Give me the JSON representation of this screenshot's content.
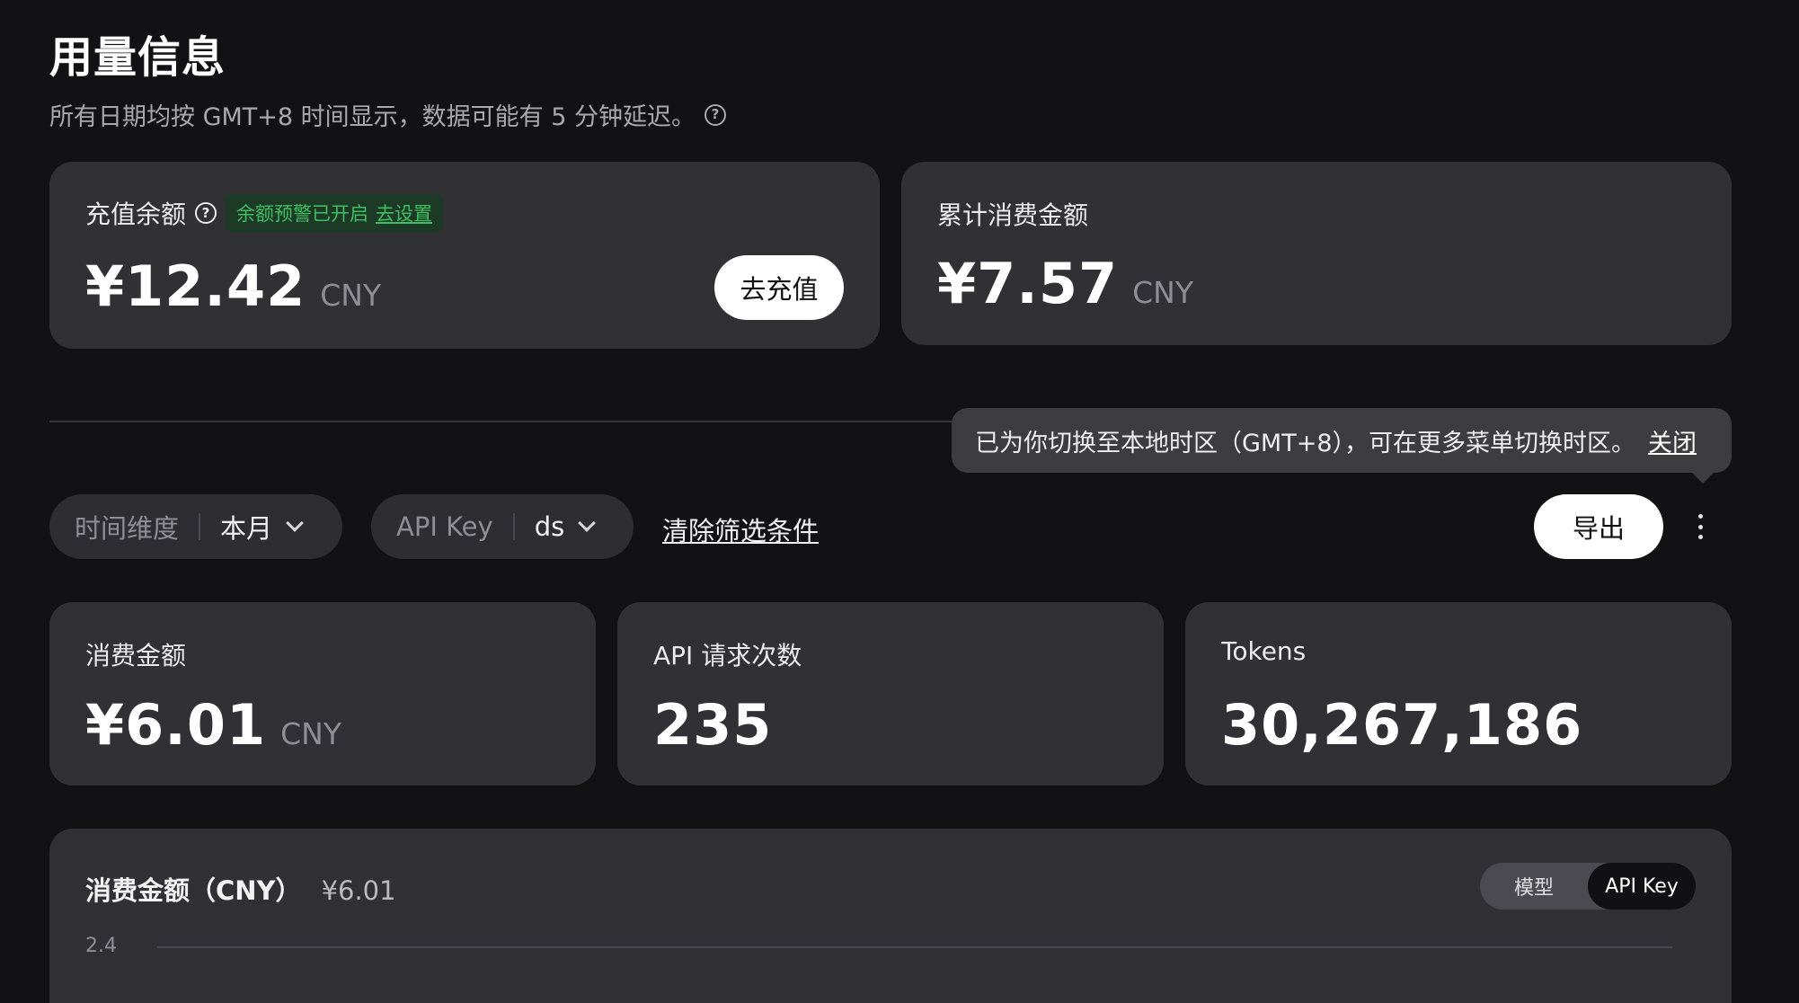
{
  "header": {
    "title": "用量信息",
    "subtitle": "所有日期均按 GMT+8 时间显示，数据可能有 5 分钟延迟。"
  },
  "balance_card": {
    "label": "充值余额",
    "badge_text": "余额预警已开启",
    "badge_link": "去设置",
    "amount": "¥12.42",
    "unit": "CNY",
    "recharge_button": "去充值"
  },
  "total_spend_card": {
    "label": "累计消费金额",
    "amount": "¥7.57",
    "unit": "CNY"
  },
  "tooltip": {
    "text": "已为你切换至本地时区（GMT+8），可在更多菜单切换时区。",
    "close": "关闭"
  },
  "filters": {
    "time": {
      "label": "时间维度",
      "value": "本月"
    },
    "api_key": {
      "label": "API Key",
      "value": "ds"
    },
    "clear": "清除筛选条件",
    "export": "导出"
  },
  "stats": [
    {
      "label": "消费金额",
      "value": "¥6.01",
      "unit": "CNY"
    },
    {
      "label": "API 请求次数",
      "value": "235",
      "unit": ""
    },
    {
      "label": "Tokens",
      "value": "30,267,186",
      "unit": ""
    }
  ],
  "chart_panel": {
    "title": "消费金额（CNY）",
    "total": "¥6.01",
    "toggle": [
      "模型",
      "API Key"
    ],
    "active_toggle": "API Key",
    "y_tick_top": "2.4"
  },
  "colors": {
    "background": "#121214",
    "card": "#313135",
    "accent_green": "#3fbf63",
    "badge_bg": "#1d3a26"
  }
}
